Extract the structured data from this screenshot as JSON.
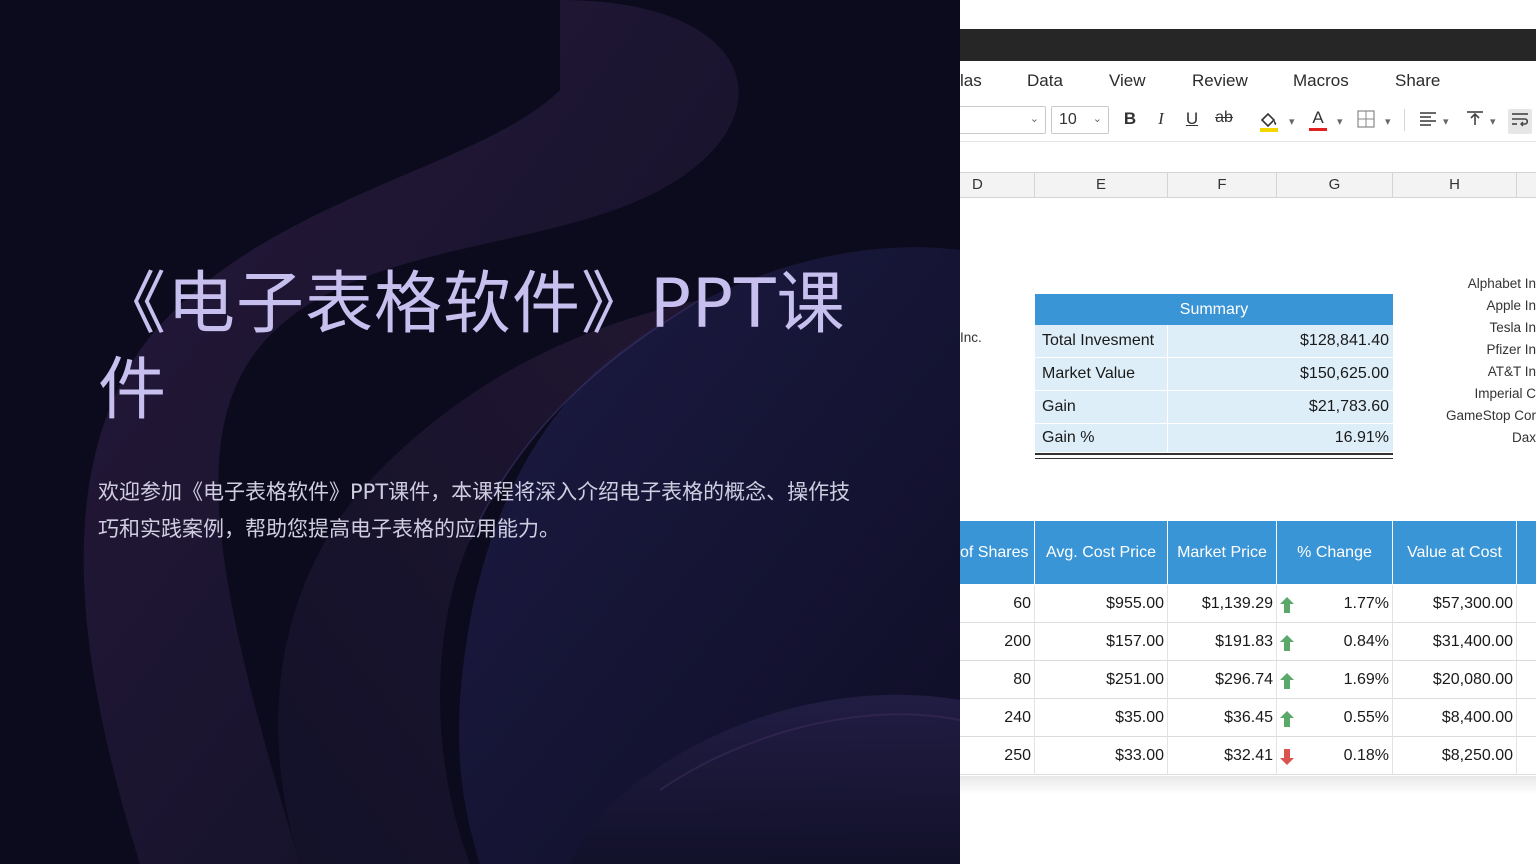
{
  "slide": {
    "title": "《电子表格软件》PPT课件",
    "subtitle": "欢迎参加《电子表格软件》PPT课件，本课程将深入介绍电子表格的概念、操作技巧和实践案例，帮助您提高电子表格的应用能力。"
  },
  "spreadsheet": {
    "menu": [
      "las",
      "Data",
      "View",
      "Review",
      "Macros",
      "Share"
    ],
    "toolbar": {
      "font_size": "10",
      "bold": "B",
      "italic": "I",
      "underline": "U",
      "strikethrough": "ab",
      "font_color": "A"
    },
    "columns": [
      "D",
      "E",
      "F",
      "G",
      "H"
    ],
    "left_clip_label": "Inc.",
    "company_labels": [
      "Alphabet In",
      "Apple In",
      "Tesla In",
      "Pfizer In",
      "AT&T In",
      "Imperial C",
      "GameStop Cor",
      "Dax"
    ],
    "summary": {
      "title": "Summary",
      "rows": [
        {
          "label": "Total Invesment",
          "value": "$128,841.40"
        },
        {
          "label": "Market Value",
          "value": "$150,625.00"
        },
        {
          "label": "Gain",
          "value": "$21,783.60"
        },
        {
          "label": "Gain %",
          "value": "16.91%"
        }
      ]
    },
    "table": {
      "headers": [
        "of Shares",
        "Avg. Cost Price",
        "Market Price",
        "% Change",
        "Value at Cost"
      ],
      "rows": [
        {
          "shares": "60",
          "avg_cost": "$955.00",
          "market": "$1,139.29",
          "trend": "up",
          "change": "1.77%",
          "value_cost": "$57,300.00"
        },
        {
          "shares": "200",
          "avg_cost": "$157.00",
          "market": "$191.83",
          "trend": "up",
          "change": "0.84%",
          "value_cost": "$31,400.00"
        },
        {
          "shares": "80",
          "avg_cost": "$251.00",
          "market": "$296.74",
          "trend": "up",
          "change": "1.69%",
          "value_cost": "$20,080.00"
        },
        {
          "shares": "240",
          "avg_cost": "$35.00",
          "market": "$36.45",
          "trend": "up",
          "change": "0.55%",
          "value_cost": "$8,400.00"
        },
        {
          "shares": "250",
          "avg_cost": "$33.00",
          "market": "$32.41",
          "trend": "down",
          "change": "0.18%",
          "value_cost": "$8,250.00"
        }
      ]
    },
    "colors": {
      "header_blue": "#3a95d6",
      "summary_fill": "#ddeef9",
      "up_arrow": "#5aa86a",
      "down_arrow": "#d9534f"
    }
  }
}
